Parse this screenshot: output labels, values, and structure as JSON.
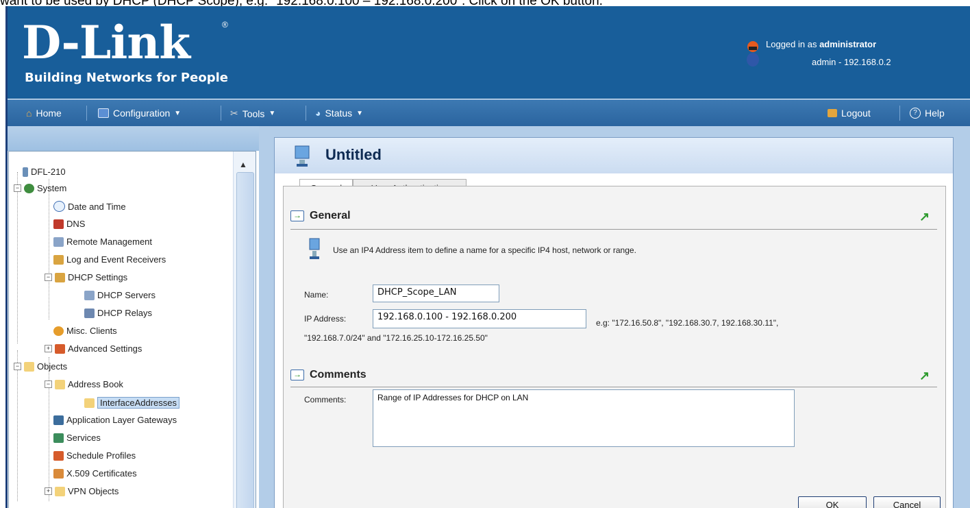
{
  "caption": "want to be used by DHCP (DHCP Scope), e.g. \"192.168.0.100 – 192.168.0.200\". Click on the OK button.",
  "header": {
    "logo": "D-Link",
    "tagline": "Building Networks for People",
    "logged_in_prefix": "Logged in as ",
    "logged_in_user": "administrator",
    "admin_line": "admin - 192.168.0.2"
  },
  "menu": {
    "home": "Home",
    "configuration": "Configuration",
    "tools": "Tools",
    "status": "Status",
    "logout": "Logout",
    "help": "Help"
  },
  "tree": {
    "root": "DFL-210",
    "system": "System",
    "date_time": "Date and Time",
    "dns": "DNS",
    "remote_mgmt": "Remote Management",
    "log_receivers": "Log and Event Receivers",
    "dhcp_settings": "DHCP Settings",
    "dhcp_servers": "DHCP Servers",
    "dhcp_relays": "DHCP Relays",
    "misc_clients": "Misc. Clients",
    "advanced": "Advanced Settings",
    "objects": "Objects",
    "address_book": "Address Book",
    "interface_addresses": "InterfaceAddresses",
    "alg": "Application Layer Gateways",
    "services": "Services",
    "schedule": "Schedule Profiles",
    "x509": "X.509 Certificates",
    "vpn": "VPN Objects"
  },
  "panel": {
    "title": "Untitled",
    "tab_general": "General",
    "tab_user_auth": "User Authentication",
    "section_general": "General",
    "info": "Use an IP4 Address item to define a name for a specific IP4 host, network or range.",
    "name_label": "Name:",
    "name_value": "DHCP_Scope_LAN",
    "ip_label": "IP Address:",
    "ip_value": "192.168.0.100 - 192.168.0.200",
    "hint_line1": "e.g: \"172.16.50.8\", \"192.168.30.7, 192.168.30.11\",",
    "hint_line2": "\"192.168.7.0/24\" and \"172.16.25.10-172.16.25.50\"",
    "section_comments": "Comments",
    "comments_label": "Comments:",
    "comments_value": "Range of IP Addresses for DHCP on LAN",
    "ok": "OK",
    "cancel": "Cancel"
  },
  "colors": {
    "header_blue": "#185e9a",
    "menu_blue": "#3d79b2",
    "panel_bg": "#b3cde8"
  }
}
